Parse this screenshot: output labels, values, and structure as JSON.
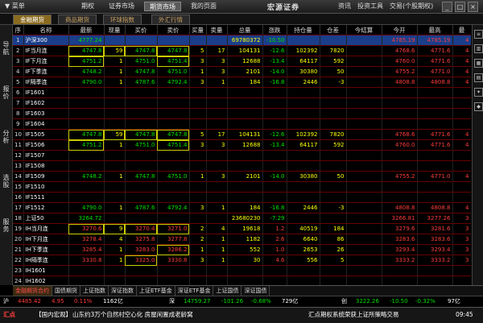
{
  "window": {
    "menu": "菜单",
    "nav_tabs": [
      "期权",
      "证券市场",
      "期货市场",
      "我的页面"
    ],
    "active_nav": 2,
    "app_title": "宏源证券",
    "right_menus": [
      "资讯",
      "投资工具",
      "交易(个股期权)"
    ],
    "controls": [
      "_",
      "□",
      "×"
    ]
  },
  "subtabs": [
    "金融期货",
    "商品期货",
    "环球指数",
    "外汇行情"
  ],
  "active_subtab": 0,
  "sidebar": [
    "导航",
    "报价",
    "分析",
    "选股",
    "服务"
  ],
  "table": {
    "headers": [
      "序",
      "名称",
      "最新",
      "现量",
      "买价",
      "卖价",
      "买量",
      "卖量",
      "总量",
      "涨跌",
      "持仓量",
      "仓差",
      "今结算",
      "今开",
      "最高",
      "最"
    ],
    "rows": [
      [
        "1",
        "沪深300",
        "4777.24",
        "",
        "",
        "",
        "",
        "",
        "69780372",
        "-10.50",
        "",
        "",
        "",
        "4785.19",
        "4785.19",
        "4"
      ],
      [
        "2",
        "IF当月连",
        "4747.8",
        "59",
        "4747.8",
        "4747.8",
        "5",
        "17",
        "104131",
        "-12.6",
        "102392",
        "7820",
        "",
        "4768.6",
        "4771.6",
        "4"
      ],
      [
        "3",
        "IF下月连",
        "4751.2",
        "1",
        "4751.0",
        "4751.4",
        "3",
        "3",
        "12688",
        "-13.4",
        "64117",
        "592",
        "",
        "4760.0",
        "4771.6",
        "4"
      ],
      [
        "4",
        "IF下季连",
        "4748.2",
        "1",
        "4747.8",
        "4751.0",
        "1",
        "3",
        "2101",
        "-14.0",
        "30380",
        "50",
        "",
        "4755.2",
        "4771.0",
        "4"
      ],
      [
        "5",
        "IF隔季连",
        "4790.0",
        "1",
        "4787.6",
        "4792.4",
        "3",
        "1",
        "184",
        "-16.8",
        "2446",
        "-3",
        "",
        "4808.8",
        "4808.8",
        "4"
      ],
      [
        "6",
        "IF1601",
        "",
        "",
        "",
        "",
        "",
        "",
        "",
        "",
        "",
        "",
        "",
        "",
        "",
        ""
      ],
      [
        "7",
        "IF1602",
        "",
        "",
        "",
        "",
        "",
        "",
        "",
        "",
        "",
        "",
        "",
        "",
        "",
        ""
      ],
      [
        "8",
        "IF1603",
        "",
        "",
        "",
        "",
        "",
        "",
        "",
        "",
        "",
        "",
        "",
        "",
        "",
        ""
      ],
      [
        "9",
        "IF1604",
        "",
        "",
        "",
        "",
        "",
        "",
        "",
        "",
        "",
        "",
        "",
        "",
        "",
        ""
      ],
      [
        "10",
        "IF1505",
        "4747.8",
        "59",
        "4747.8",
        "4747.8",
        "5",
        "17",
        "104131",
        "-12.6",
        "102392",
        "7820",
        "",
        "4768.6",
        "4771.6",
        "4"
      ],
      [
        "11",
        "IF1506",
        "4751.2",
        "1",
        "4751.0",
        "4751.4",
        "3",
        "3",
        "12688",
        "-13.4",
        "64117",
        "592",
        "",
        "4760.0",
        "4771.6",
        "4"
      ],
      [
        "12",
        "IF1507",
        "",
        "",
        "",
        "",
        "",
        "",
        "",
        "",
        "",
        "",
        "",
        "",
        "",
        ""
      ],
      [
        "13",
        "IF1508",
        "",
        "",
        "",
        "",
        "",
        "",
        "",
        "",
        "",
        "",
        "",
        "",
        "",
        ""
      ],
      [
        "14",
        "IF1509",
        "4748.2",
        "1",
        "4747.8",
        "4751.0",
        "1",
        "3",
        "2101",
        "-14.0",
        "30380",
        "50",
        "",
        "4755.2",
        "4771.0",
        "4"
      ],
      [
        "15",
        "IF1510",
        "",
        "",
        "",
        "",
        "",
        "",
        "",
        "",
        "",
        "",
        "",
        "",
        "",
        ""
      ],
      [
        "16",
        "IF1511",
        "",
        "",
        "",
        "",
        "",
        "",
        "",
        "",
        "",
        "",
        "",
        "",
        "",
        ""
      ],
      [
        "17",
        "IF1512",
        "4790.0",
        "1",
        "4787.6",
        "4792.4",
        "3",
        "1",
        "184",
        "-16.8",
        "2446",
        "-3",
        "",
        "4808.8",
        "4808.8",
        "4"
      ],
      [
        "18",
        "上证50",
        "3264.72",
        "",
        "",
        "",
        "",
        "",
        "23680230",
        "-7.29",
        "",
        "",
        "",
        "3266.81",
        "3277.26",
        "3"
      ],
      [
        "19",
        "IH当月连",
        "3270.6",
        "9",
        "3270.4",
        "3271.0",
        "2",
        "4",
        "19618",
        "1.2",
        "40519",
        "184",
        "",
        "3279.6",
        "3281.6",
        "3"
      ],
      [
        "20",
        "IH下月连",
        "3278.4",
        "4",
        "3275.8",
        "3277.8",
        "2",
        "1",
        "1182",
        "2.6",
        "6640",
        "86",
        "",
        "3283.6",
        "3283.6",
        "3"
      ],
      [
        "21",
        "IH下季连",
        "3285.4",
        "1",
        "3283.0",
        "3286.2",
        "1",
        "1",
        "552",
        "1.0",
        "2653",
        "26",
        "",
        "3293.4",
        "3293.4",
        "3"
      ],
      [
        "22",
        "IH隔季连",
        "3330.8",
        "1",
        "3325.0",
        "3330.8",
        "3",
        "1",
        "30",
        "4.6",
        "556",
        "5",
        "",
        "3333.2",
        "3333.2",
        "3"
      ],
      [
        "23",
        "IH1601",
        "",
        "",
        "",
        "",
        "",
        "",
        "",
        "",
        "",
        "",
        "",
        "",
        "",
        ""
      ],
      [
        "24",
        "IH1602",
        "",
        "",
        "",
        "",
        "",
        "",
        "",
        "",
        "",
        "",
        "",
        "",
        "",
        ""
      ],
      [
        "25",
        "IH1603",
        "",
        "",
        "",
        "",
        "",
        "",
        "",
        "",
        "",
        "",
        "",
        "",
        "",
        ""
      ]
    ]
  },
  "bottom_tabs": [
    "金融期货合约",
    "国债期货",
    "上证指数",
    "深证指数",
    "上证ETF基金",
    "深证ETF基金",
    "上证国债",
    "深证国债"
  ],
  "index_bar": [
    {
      "text": "沪",
      "color": "white"
    },
    {
      "text": "4485.42",
      "color": "red"
    },
    {
      "text": "4.95",
      "color": "red"
    },
    {
      "text": "0.11%",
      "color": "red"
    },
    {
      "text": "1162亿",
      "color": "white"
    },
    {
      "text": "深",
      "color": "white"
    },
    {
      "text": "14759.27",
      "color": "green"
    },
    {
      "text": "-101.26",
      "color": "green"
    },
    {
      "text": "-0.68%",
      "color": "green"
    },
    {
      "text": "729亿",
      "color": "white"
    },
    {
      "text": "创",
      "color": "white"
    },
    {
      "text": "3222.26",
      "color": "green"
    },
    {
      "text": "-10.50",
      "color": "green"
    },
    {
      "text": "-0.32%",
      "color": "green"
    },
    {
      "text": "97亿",
      "color": "white"
    }
  ],
  "status_bar": {
    "brand": "汇点",
    "news_tag": "【国内宏观】",
    "news_text": "山东约3万个自然村空心化 房屋闲置成老龄窝",
    "notice": "汇点期权系统荣获上证所策略交易",
    "time": "09:45"
  },
  "colors": {
    "up": "#ff3c3c",
    "down": "#00e000",
    "volume": "#ffff00",
    "selected_row": "#1a3e8a",
    "grid_line": "#660000"
  }
}
